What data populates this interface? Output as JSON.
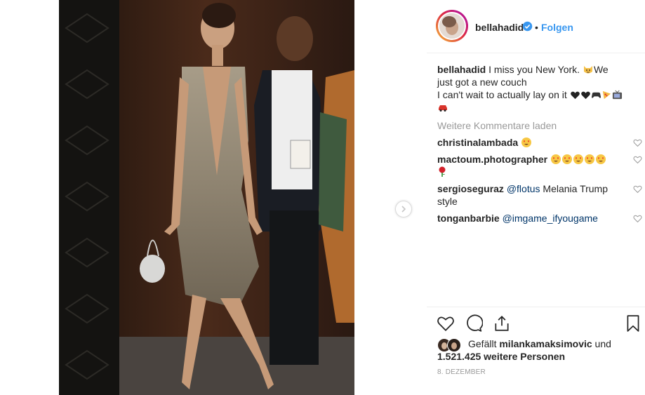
{
  "post": {
    "username": "bellahadid",
    "follow_dot": "•",
    "follow_label": "Folgen"
  },
  "caption": {
    "username": "bellahadid",
    "text_1": "I miss you New York.",
    "text_2": "We just got a new couch",
    "text_3": "I can't wait to actually lay on it"
  },
  "load_more_label": "Weitere Kommentare laden",
  "comments": [
    {
      "username": "christinalambada",
      "text": ""
    },
    {
      "username": "mactoum.photographer",
      "text": ""
    },
    {
      "username": "sergioseguraz",
      "mention": "@flotus",
      "text": "Melania Trump style"
    },
    {
      "username": "tonganbarbie",
      "mention": "@imgame_ifyougame",
      "text": ""
    }
  ],
  "likes": {
    "prefix": "Gefällt",
    "liker": "milankamaksimovic",
    "conj": "und",
    "count_text": "1.521.425 weitere Personen"
  },
  "date": "8. DEZEMBER",
  "icons": {
    "verified": "verified-badge-icon",
    "heart": "heart-icon",
    "comment": "comment-icon",
    "share": "share-icon",
    "bookmark": "bookmark-icon",
    "next": "chevron-right-icon"
  },
  "colors": {
    "link": "#3897f0",
    "text": "#262626",
    "muted": "#999999",
    "mention": "#003569",
    "border": "#efefef"
  }
}
